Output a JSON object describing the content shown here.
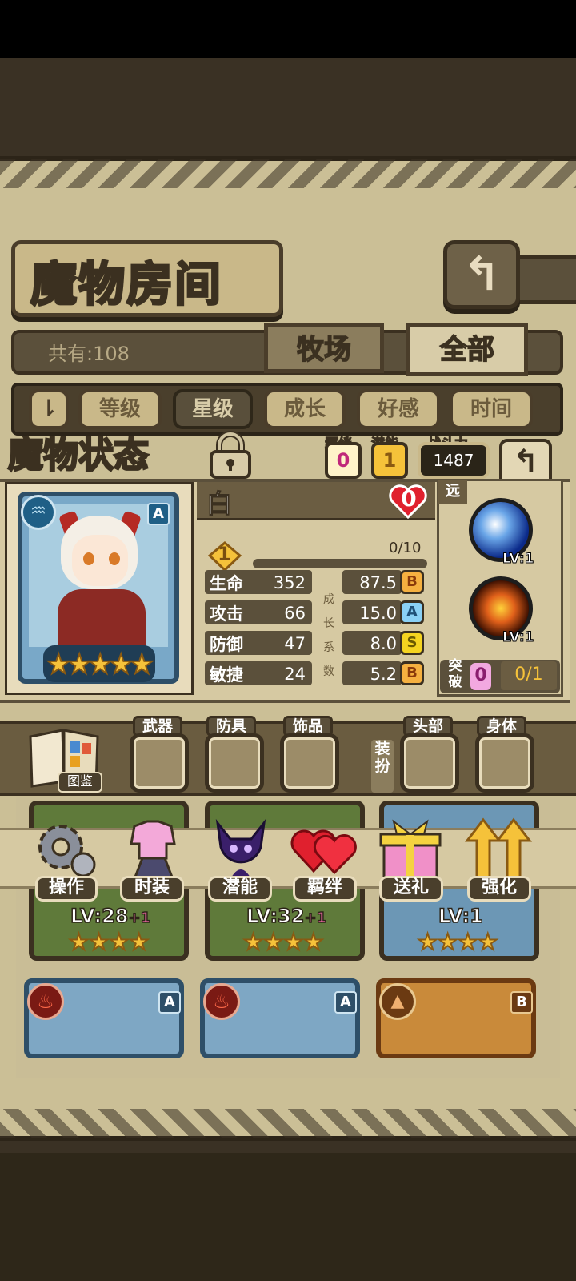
{
  "header": {
    "title": "魔物房间",
    "back_icon": "back-arrow-icon"
  },
  "summary": {
    "count_text": "共有:108"
  },
  "tabs": [
    {
      "label": "牧场"
    },
    {
      "label": "全部"
    }
  ],
  "sort": {
    "buttons": [
      {
        "label": "等级"
      },
      {
        "label": "星级"
      },
      {
        "label": "成长"
      },
      {
        "label": "好感"
      },
      {
        "label": "时间"
      }
    ],
    "active": "星级"
  },
  "status": {
    "title": "魔物状态",
    "bond_label": "羁绊",
    "bond_value": "0",
    "potential_label": "潜能",
    "potential_value": "1",
    "power_label": "战斗力",
    "power_value": "1487",
    "name": "白",
    "affection": "0",
    "level": "1",
    "exp": "0/10",
    "rank": "A",
    "stars": 5,
    "stats": [
      {
        "label": "生命",
        "value": "352",
        "growth": "87.5",
        "grade": "B"
      },
      {
        "label": "攻击",
        "value": "66",
        "growth": "15.0",
        "grade": "A"
      },
      {
        "label": "防御",
        "value": "47",
        "growth": "8.0",
        "grade": "S"
      },
      {
        "label": "敏捷",
        "value": "24",
        "growth": "5.2",
        "grade": "B"
      }
    ],
    "growth_chars": [
      "成",
      "长",
      "系",
      "数"
    ],
    "range": "远",
    "skills": [
      {
        "lv": "LV:1",
        "icon": "wave-skill-icon"
      },
      {
        "lv": "LV:1",
        "icon": "fire-sword-skill-icon"
      }
    ],
    "breakthrough_label": "突破",
    "breakthrough_count": "0",
    "breakthrough_progress": "0/1"
  },
  "equipment": {
    "book_label": "图鉴",
    "slots": [
      {
        "label": "武器"
      },
      {
        "label": "防具"
      },
      {
        "label": "饰品"
      },
      {
        "label": "头部"
      },
      {
        "label": "身体"
      }
    ],
    "dress_label": "装扮"
  },
  "actions": [
    {
      "label": "操作",
      "icon": "gear-icon"
    },
    {
      "label": "时装",
      "icon": "outfit-icon"
    },
    {
      "label": "潜能",
      "icon": "demon-icon"
    },
    {
      "label": "羁绊",
      "icon": "hearts-icon"
    },
    {
      "label": "送礼",
      "icon": "gift-icon"
    },
    {
      "label": "强化",
      "icon": "upgrade-arrows-icon"
    }
  ],
  "grid_cards": [
    {
      "level": "LV:28",
      "plus": "+1"
    },
    {
      "level": "LV:32",
      "plus": "+1"
    },
    {
      "level": "LV:1",
      "plus": ""
    }
  ],
  "grid_ranks": [
    "A",
    "A",
    "B"
  ],
  "colors": {
    "gold": "#f5c23a",
    "panel": "#d6c9a2",
    "dark": "#3b3020",
    "water": "#1f5f86"
  }
}
